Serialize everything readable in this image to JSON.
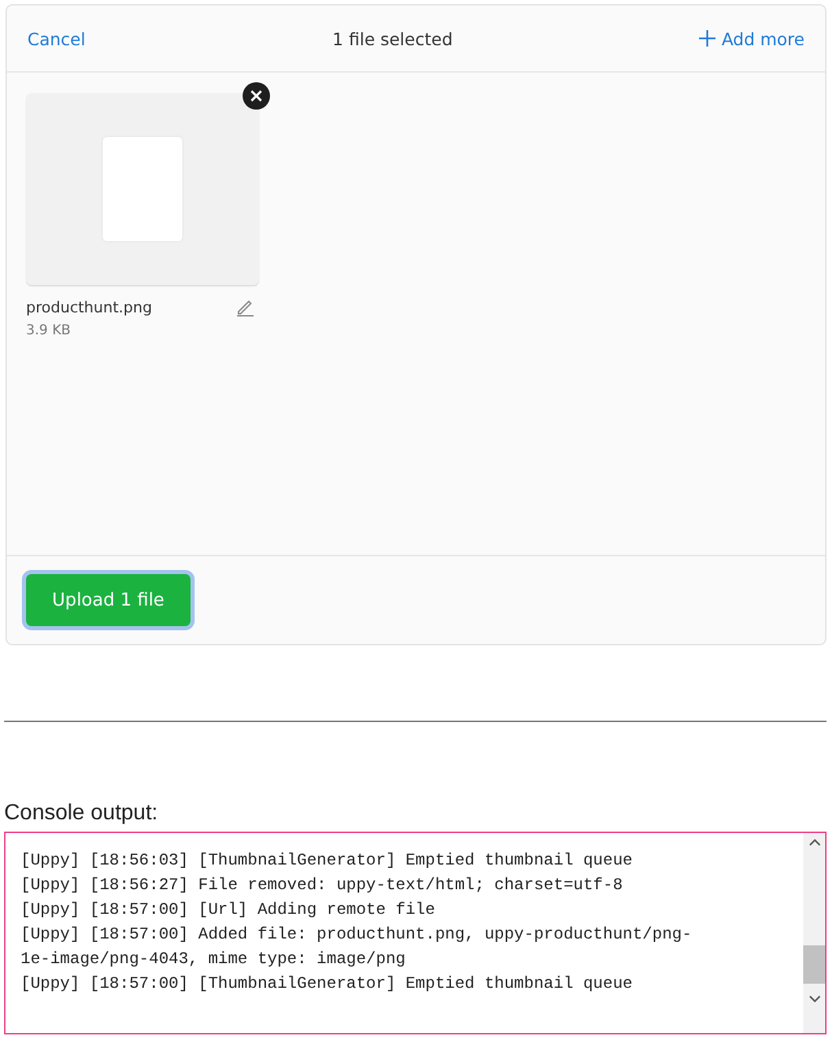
{
  "header": {
    "cancel": "Cancel",
    "title": "1 file selected",
    "add_more": "Add more"
  },
  "files": [
    {
      "name": "producthunt.png",
      "size": "3.9 KB"
    }
  ],
  "upload_button": "Upload 1 file",
  "console": {
    "label": "Console output:",
    "lines": [
      "[Uppy] [18:56:03] [ThumbnailGenerator] Emptied thumbnail queue",
      "[Uppy] [18:56:27] File removed: uppy-text/html; charset=utf-8",
      "[Uppy] [18:57:00] [Url] Adding remote file",
      "[Uppy] [18:57:00] Added file: producthunt.png, uppy-producthunt/png-1e-image/png-4043, mime type: image/png",
      "[Uppy] [18:57:00] [ThumbnailGenerator] Emptied thumbnail queue"
    ]
  }
}
